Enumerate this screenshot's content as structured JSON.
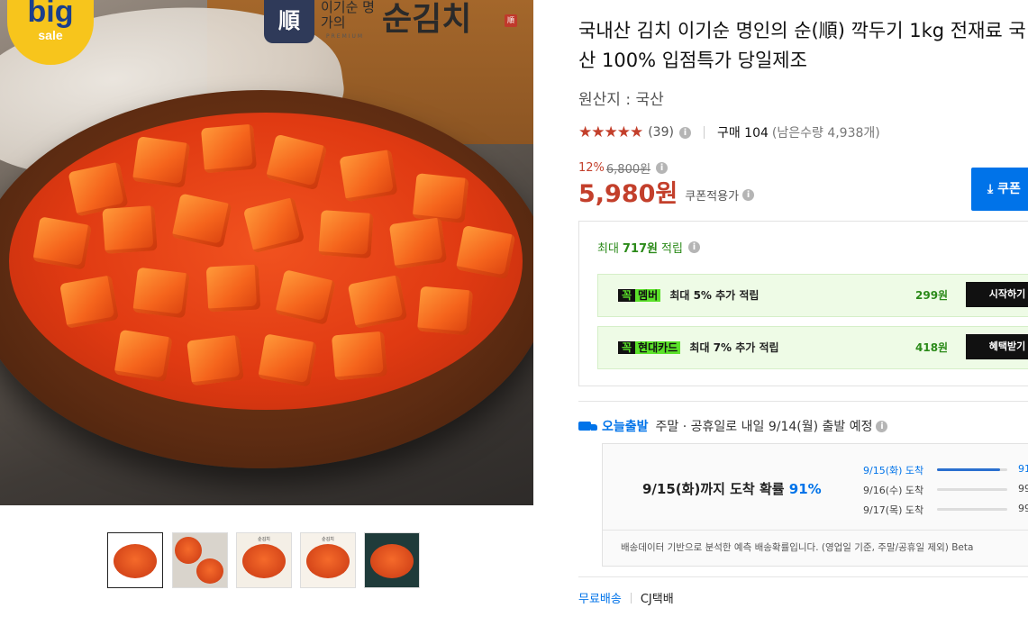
{
  "image": {
    "logo_big": "big",
    "logo_sale": "sale",
    "brand_emblem": "順",
    "brand_small": "이기순 명가의",
    "brand_sub": "PREMIUM",
    "brand_big": "순김치",
    "brand_seal": "順"
  },
  "thumbnails": [
    {
      "label": "",
      "active": true
    },
    {
      "label": ""
    },
    {
      "label": "순김치"
    },
    {
      "label": "순김치"
    },
    {
      "label": ""
    }
  ],
  "product": {
    "title": "국내산 김치 이기순 명인의 순(順) 깍두기 1kg 전재료 국산 100% 입점특가 당일제조",
    "origin": "원산지 : 국산",
    "stars": "★★★★★",
    "rating_fraction": 0.9,
    "review_count": "(39)",
    "purchase": "구매 104",
    "stock": "(남은수량 4,938개)"
  },
  "price": {
    "discount": "12%",
    "original": "6,800원",
    "final": "5,980원",
    "coupon_label": "쿠폰적용가",
    "coupon_button": "쿠폰"
  },
  "reward": {
    "head_prefix": "최대",
    "head_amount": "717원",
    "head_suffix": "적립",
    "benefits": [
      {
        "tag_k": "꼭",
        "tag_name": "멤버",
        "desc": "최대 5% 추가 적립",
        "amount": "299원",
        "action": "시작하기"
      },
      {
        "tag_k": "꼭",
        "tag_name": "현대카드",
        "desc": "최대 7% 추가 적립",
        "amount": "418원",
        "action": "혜택받기"
      }
    ]
  },
  "shipping": {
    "today_label": "오늘출발",
    "notice": "주말 · 공휴일로 내일 9/14(월) 출발 예정",
    "prob_main": "9/15(화)까지 도착 확률",
    "prob_pct": "91%",
    "lines": [
      {
        "date": "9/15(화) 도착",
        "value": "91",
        "fill": 0.9
      },
      {
        "date": "9/16(수) 도착",
        "value": "99",
        "fill": 0.0
      },
      {
        "date": "9/17(목) 도착",
        "value": "99",
        "fill": 0.0
      }
    ],
    "note": "배송데이터 기반으로 분석한 예측 배송확률입니다. (영업일 기준, 주말/공휴일 제외) Beta"
  },
  "delivery": {
    "free": "무료배송",
    "carrier": "CJ택배"
  }
}
